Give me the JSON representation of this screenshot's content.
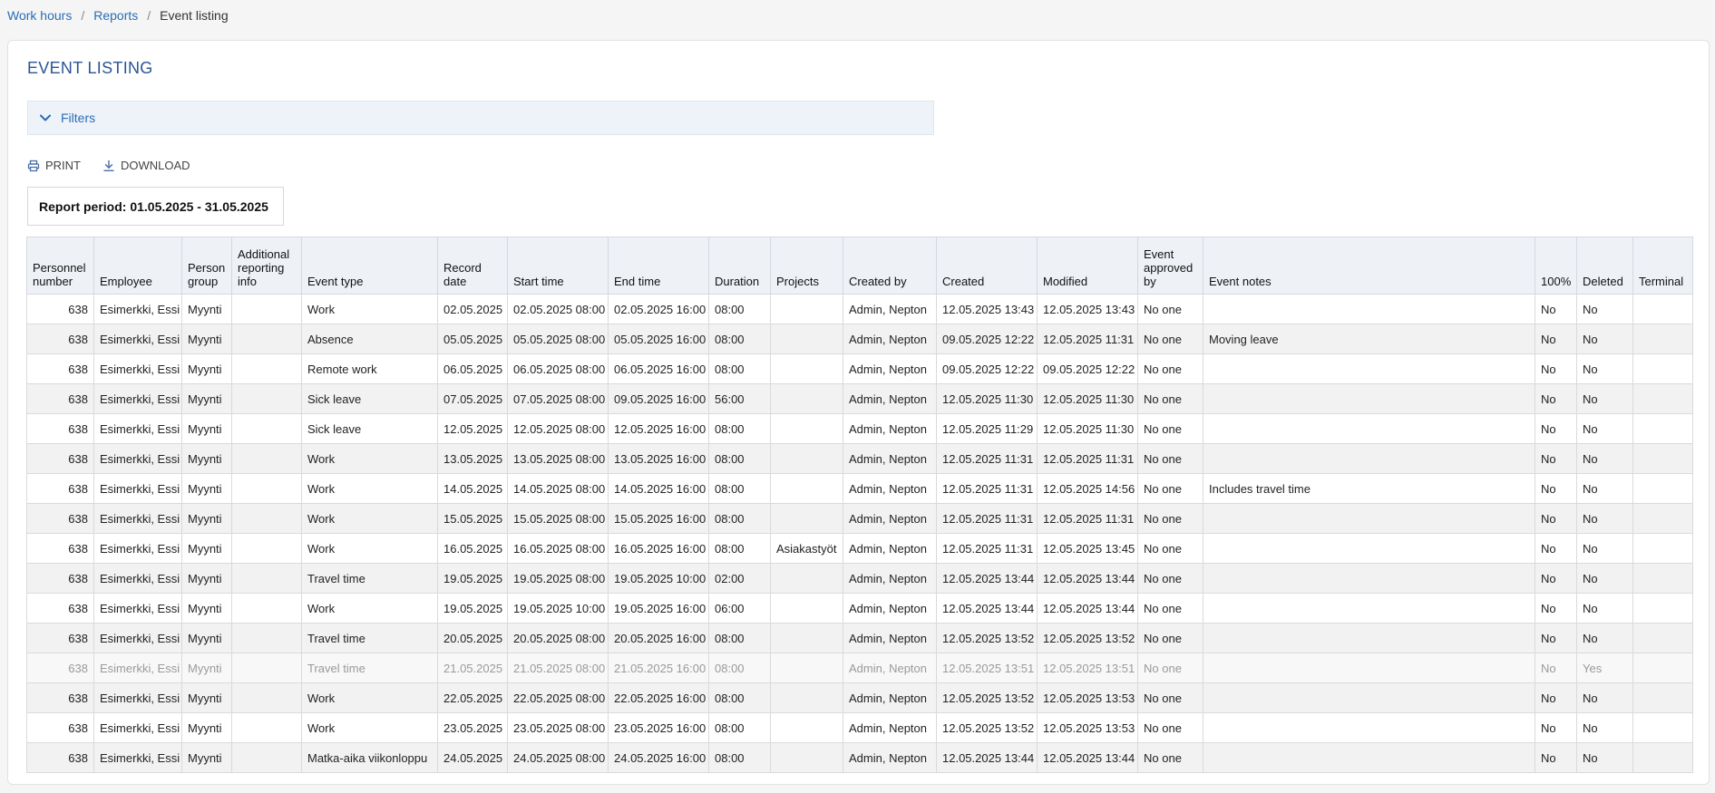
{
  "breadcrumb": {
    "items": [
      "Work hours",
      "Reports"
    ],
    "current": "Event listing"
  },
  "page": {
    "title": "EVENT LISTING",
    "filters_label": "Filters",
    "print_label": "PRINT",
    "download_label": "DOWNLOAD",
    "report_period": "Report period: 01.05.2025 - 31.05.2025"
  },
  "colors": {
    "link": "#2a6db5",
    "title": "#2a5595",
    "header_bg": "#eef2f7",
    "stripe": "#f2f2f2"
  },
  "table": {
    "headers": [
      {
        "key": "pn",
        "label": "Personnel number"
      },
      {
        "key": "emp",
        "label": "Employee"
      },
      {
        "key": "grp",
        "label": "Person group"
      },
      {
        "key": "info",
        "label": "Additional reporting info"
      },
      {
        "key": "type",
        "label": "Event type"
      },
      {
        "key": "rec",
        "label": "Record date"
      },
      {
        "key": "start",
        "label": "Start time"
      },
      {
        "key": "end",
        "label": "End time"
      },
      {
        "key": "dur",
        "label": "Duration"
      },
      {
        "key": "proj",
        "label": "Projects"
      },
      {
        "key": "cby",
        "label": "Created by"
      },
      {
        "key": "created",
        "label": "Created"
      },
      {
        "key": "mod",
        "label": "Modified"
      },
      {
        "key": "appr",
        "label": "Event approved by"
      },
      {
        "key": "notes",
        "label": "Event notes"
      },
      {
        "key": "pct",
        "label": "100%"
      },
      {
        "key": "del",
        "label": "Deleted"
      },
      {
        "key": "term",
        "label": "Terminal"
      }
    ],
    "rows": [
      {
        "pn": "638",
        "emp": "Esimerkki, Essi",
        "grp": "Myynti",
        "info": "",
        "type": "Work",
        "rec": "02.05.2025",
        "start": "02.05.2025 08:00",
        "end": "02.05.2025 16:00",
        "dur": "08:00",
        "proj": "",
        "cby": "Admin, Nepton",
        "created": "12.05.2025 13:43",
        "mod": "12.05.2025 13:43",
        "appr": "No one",
        "notes": "",
        "pct": "No",
        "del": "No",
        "term": ""
      },
      {
        "pn": "638",
        "emp": "Esimerkki, Essi",
        "grp": "Myynti",
        "info": "",
        "type": "Absence",
        "rec": "05.05.2025",
        "start": "05.05.2025 08:00",
        "end": "05.05.2025 16:00",
        "dur": "08:00",
        "proj": "",
        "cby": "Admin, Nepton",
        "created": "09.05.2025 12:22",
        "mod": "12.05.2025 11:31",
        "appr": "No one",
        "notes": "Moving leave",
        "pct": "No",
        "del": "No",
        "term": ""
      },
      {
        "pn": "638",
        "emp": "Esimerkki, Essi",
        "grp": "Myynti",
        "info": "",
        "type": "Remote work",
        "rec": "06.05.2025",
        "start": "06.05.2025 08:00",
        "end": "06.05.2025 16:00",
        "dur": "08:00",
        "proj": "",
        "cby": "Admin, Nepton",
        "created": "09.05.2025 12:22",
        "mod": "09.05.2025 12:22",
        "appr": "No one",
        "notes": "",
        "pct": "No",
        "del": "No",
        "term": ""
      },
      {
        "pn": "638",
        "emp": "Esimerkki, Essi",
        "grp": "Myynti",
        "info": "",
        "type": "Sick leave",
        "rec": "07.05.2025",
        "start": "07.05.2025 08:00",
        "end": "09.05.2025 16:00",
        "dur": "56:00",
        "proj": "",
        "cby": "Admin, Nepton",
        "created": "12.05.2025 11:30",
        "mod": "12.05.2025 11:30",
        "appr": "No one",
        "notes": "",
        "pct": "No",
        "del": "No",
        "term": ""
      },
      {
        "pn": "638",
        "emp": "Esimerkki, Essi",
        "grp": "Myynti",
        "info": "",
        "type": "Sick leave",
        "rec": "12.05.2025",
        "start": "12.05.2025 08:00",
        "end": "12.05.2025 16:00",
        "dur": "08:00",
        "proj": "",
        "cby": "Admin, Nepton",
        "created": "12.05.2025 11:29",
        "mod": "12.05.2025 11:30",
        "appr": "No one",
        "notes": "",
        "pct": "No",
        "del": "No",
        "term": ""
      },
      {
        "pn": "638",
        "emp": "Esimerkki, Essi",
        "grp": "Myynti",
        "info": "",
        "type": "Work",
        "rec": "13.05.2025",
        "start": "13.05.2025 08:00",
        "end": "13.05.2025 16:00",
        "dur": "08:00",
        "proj": "",
        "cby": "Admin, Nepton",
        "created": "12.05.2025 11:31",
        "mod": "12.05.2025 11:31",
        "appr": "No one",
        "notes": "",
        "pct": "No",
        "del": "No",
        "term": ""
      },
      {
        "pn": "638",
        "emp": "Esimerkki, Essi",
        "grp": "Myynti",
        "info": "",
        "type": "Work",
        "rec": "14.05.2025",
        "start": "14.05.2025 08:00",
        "end": "14.05.2025 16:00",
        "dur": "08:00",
        "proj": "",
        "cby": "Admin, Nepton",
        "created": "12.05.2025 11:31",
        "mod": "12.05.2025 14:56",
        "appr": "No one",
        "notes": "Includes travel time",
        "pct": "No",
        "del": "No",
        "term": ""
      },
      {
        "pn": "638",
        "emp": "Esimerkki, Essi",
        "grp": "Myynti",
        "info": "",
        "type": "Work",
        "rec": "15.05.2025",
        "start": "15.05.2025 08:00",
        "end": "15.05.2025 16:00",
        "dur": "08:00",
        "proj": "",
        "cby": "Admin, Nepton",
        "created": "12.05.2025 11:31",
        "mod": "12.05.2025 11:31",
        "appr": "No one",
        "notes": "",
        "pct": "No",
        "del": "No",
        "term": ""
      },
      {
        "pn": "638",
        "emp": "Esimerkki, Essi",
        "grp": "Myynti",
        "info": "",
        "type": "Work",
        "rec": "16.05.2025",
        "start": "16.05.2025 08:00",
        "end": "16.05.2025 16:00",
        "dur": "08:00",
        "proj": "Asiakastyöt",
        "cby": "Admin, Nepton",
        "created": "12.05.2025 11:31",
        "mod": "12.05.2025 13:45",
        "appr": "No one",
        "notes": "",
        "pct": "No",
        "del": "No",
        "term": ""
      },
      {
        "pn": "638",
        "emp": "Esimerkki, Essi",
        "grp": "Myynti",
        "info": "",
        "type": "Travel time",
        "rec": "19.05.2025",
        "start": "19.05.2025 08:00",
        "end": "19.05.2025 10:00",
        "dur": "02:00",
        "proj": "",
        "cby": "Admin, Nepton",
        "created": "12.05.2025 13:44",
        "mod": "12.05.2025 13:44",
        "appr": "No one",
        "notes": "",
        "pct": "No",
        "del": "No",
        "term": ""
      },
      {
        "pn": "638",
        "emp": "Esimerkki, Essi",
        "grp": "Myynti",
        "info": "",
        "type": "Work",
        "rec": "19.05.2025",
        "start": "19.05.2025 10:00",
        "end": "19.05.2025 16:00",
        "dur": "06:00",
        "proj": "",
        "cby": "Admin, Nepton",
        "created": "12.05.2025 13:44",
        "mod": "12.05.2025 13:44",
        "appr": "No one",
        "notes": "",
        "pct": "No",
        "del": "No",
        "term": ""
      },
      {
        "pn": "638",
        "emp": "Esimerkki, Essi",
        "grp": "Myynti",
        "info": "",
        "type": "Travel time",
        "rec": "20.05.2025",
        "start": "20.05.2025 08:00",
        "end": "20.05.2025 16:00",
        "dur": "08:00",
        "proj": "",
        "cby": "Admin, Nepton",
        "created": "12.05.2025 13:52",
        "mod": "12.05.2025 13:52",
        "appr": "No one",
        "notes": "",
        "pct": "No",
        "del": "No",
        "term": ""
      },
      {
        "pn": "638",
        "emp": "Esimerkki, Essi",
        "grp": "Myynti",
        "info": "",
        "type": "Travel time",
        "rec": "21.05.2025",
        "start": "21.05.2025 08:00",
        "end": "21.05.2025 16:00",
        "dur": "08:00",
        "proj": "",
        "cby": "Admin, Nepton",
        "created": "12.05.2025 13:51",
        "mod": "12.05.2025 13:51",
        "appr": "No one",
        "notes": "",
        "pct": "No",
        "del": "Yes",
        "term": ""
      },
      {
        "pn": "638",
        "emp": "Esimerkki, Essi",
        "grp": "Myynti",
        "info": "",
        "type": "Work",
        "rec": "22.05.2025",
        "start": "22.05.2025 08:00",
        "end": "22.05.2025 16:00",
        "dur": "08:00",
        "proj": "",
        "cby": "Admin, Nepton",
        "created": "12.05.2025 13:52",
        "mod": "12.05.2025 13:53",
        "appr": "No one",
        "notes": "",
        "pct": "No",
        "del": "No",
        "term": ""
      },
      {
        "pn": "638",
        "emp": "Esimerkki, Essi",
        "grp": "Myynti",
        "info": "",
        "type": "Work",
        "rec": "23.05.2025",
        "start": "23.05.2025 08:00",
        "end": "23.05.2025 16:00",
        "dur": "08:00",
        "proj": "",
        "cby": "Admin, Nepton",
        "created": "12.05.2025 13:52",
        "mod": "12.05.2025 13:53",
        "appr": "No one",
        "notes": "",
        "pct": "No",
        "del": "No",
        "term": ""
      },
      {
        "pn": "638",
        "emp": "Esimerkki, Essi",
        "grp": "Myynti",
        "info": "",
        "type": "Matka-aika viikonloppu",
        "rec": "24.05.2025",
        "start": "24.05.2025 08:00",
        "end": "24.05.2025 16:00",
        "dur": "08:00",
        "proj": "",
        "cby": "Admin, Nepton",
        "created": "12.05.2025 13:44",
        "mod": "12.05.2025 13:44",
        "appr": "No one",
        "notes": "",
        "pct": "No",
        "del": "No",
        "term": ""
      }
    ]
  }
}
